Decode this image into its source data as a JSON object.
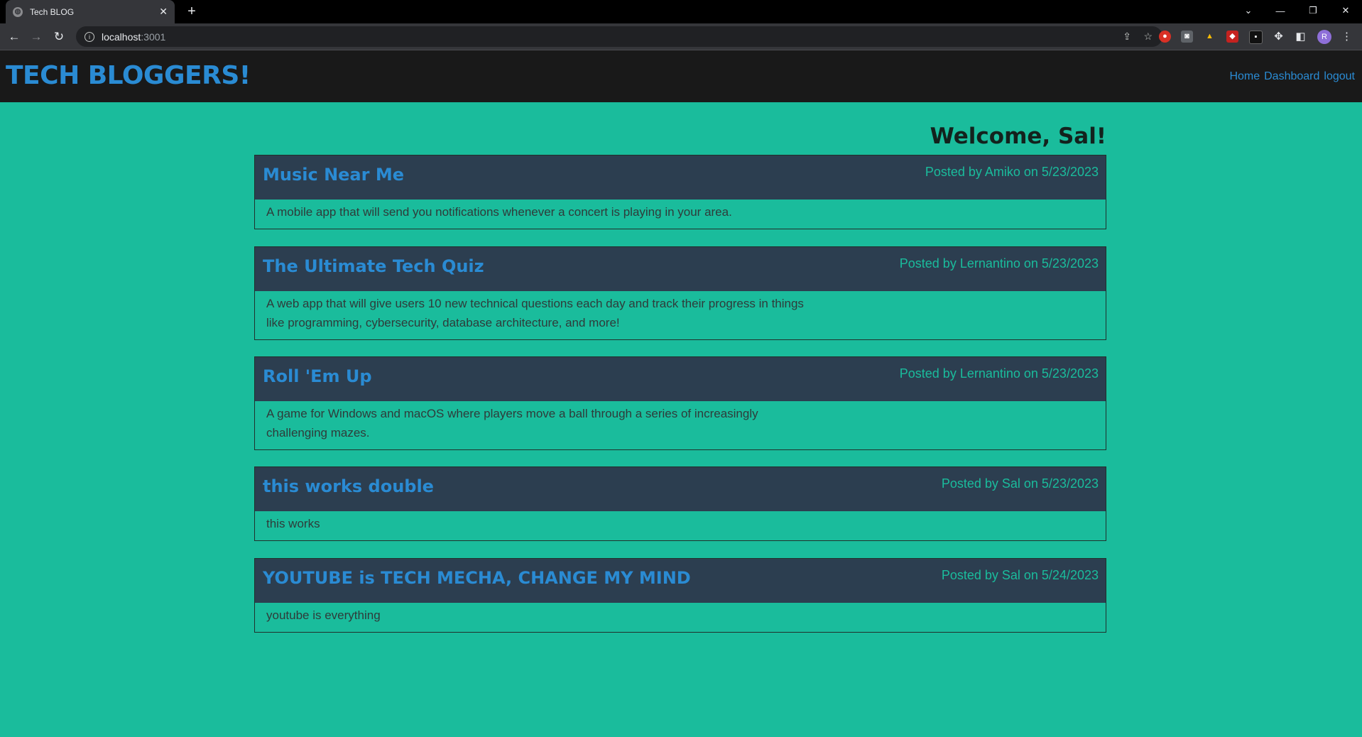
{
  "browser": {
    "tab_title": "Tech BLOG",
    "url_host": "localhost",
    "url_port": ":3001"
  },
  "header": {
    "brand": "TECH BLOGGERS!",
    "nav": [
      {
        "label": "Home"
      },
      {
        "label": "Dashboard"
      },
      {
        "label": "logout"
      }
    ]
  },
  "welcome": "Welcome, Sal!",
  "posts": [
    {
      "title": "Music Near Me",
      "meta": "Posted by Amiko on 5/23/2023",
      "body": "A mobile app that will send you notifications whenever a concert is playing in your area."
    },
    {
      "title": "The Ultimate Tech Quiz",
      "meta": "Posted by Lernantino on 5/23/2023",
      "body": "A web app that will give users 10 new technical questions each day and track their progress in things like programming, cybersecurity, database architecture, and more!"
    },
    {
      "title": "Roll 'Em Up",
      "meta": "Posted by Lernantino on 5/23/2023",
      "body": "A game for Windows and macOS where players move a ball through a series of increasingly challenging mazes."
    },
    {
      "title": "this works double",
      "meta": "Posted by Sal on 5/23/2023",
      "body": "this works"
    },
    {
      "title": "YOUTUBE is TECH MECHA, CHANGE MY MIND",
      "meta": "Posted by Sal on 5/24/2023",
      "body": "youtube is everything"
    }
  ],
  "profile_initial": "R",
  "colors": {
    "page_bg": "#1abc9c",
    "header_bg": "#191919",
    "post_head_bg": "#2c3e50",
    "link": "#2a8bd3"
  }
}
